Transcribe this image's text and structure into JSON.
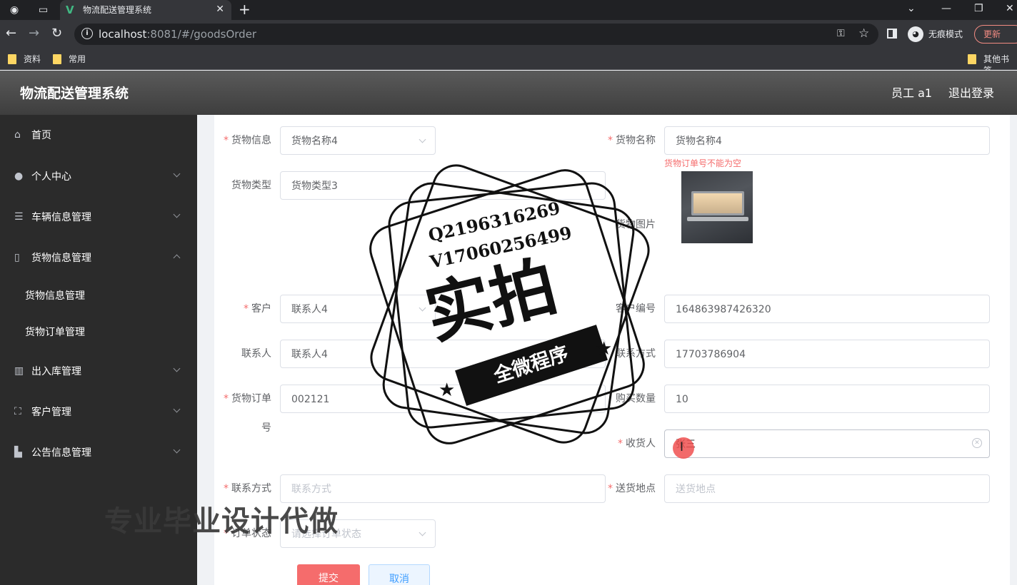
{
  "browser": {
    "tab_title": "物流配送管理系统",
    "url_host": "localhost",
    "url_rest": ":8081/#/goodsOrder",
    "incognito_label": "无痕模式",
    "update_label": "更新",
    "bookmarks": [
      "资料",
      "常用"
    ],
    "other_bookmarks": "其他书签"
  },
  "header": {
    "title": "物流配送管理系统",
    "user": "员工 a1",
    "logout": "退出登录"
  },
  "sidebar": {
    "items": [
      {
        "label": "首页",
        "icon": "home-icon"
      },
      {
        "label": "个人中心",
        "icon": "user-icon"
      },
      {
        "label": "车辆信息管理",
        "icon": "sliders-icon"
      },
      {
        "label": "货物信息管理",
        "icon": "phone-icon"
      },
      {
        "label": "货物信息管理",
        "icon": ""
      },
      {
        "label": "货物订单管理",
        "icon": ""
      },
      {
        "label": "出入库管理",
        "icon": "chart-icon"
      },
      {
        "label": "客户管理",
        "icon": "frame-icon"
      },
      {
        "label": "公告信息管理",
        "icon": "bank-icon"
      }
    ]
  },
  "form": {
    "goods_info": {
      "label": "货物信息",
      "value": "货物名称4"
    },
    "goods_name": {
      "label": "货物名称",
      "value": "货物名称4",
      "error": "货物订单号不能为空"
    },
    "goods_type": {
      "label": "货物类型",
      "value": "货物类型3"
    },
    "goods_image": {
      "label": "货物图片"
    },
    "customer": {
      "label": "客户",
      "value": "联系人4"
    },
    "customer_no": {
      "label": "客户编号",
      "value": "164863987426320"
    },
    "contact": {
      "label": "联系人",
      "value": "联系人4"
    },
    "contact_phone": {
      "label": "联系方式",
      "value": "17703786904"
    },
    "order_no": {
      "label_line1": "货物订单",
      "label_line2": "号",
      "value": "002121"
    },
    "quantity": {
      "label": "购买数量",
      "value": "10"
    },
    "receiver": {
      "label": "收货人",
      "value": "张三"
    },
    "receiver_phone": {
      "label": "联系方式",
      "placeholder": "联系方式"
    },
    "delivery_address": {
      "label": "送货地点",
      "placeholder": "送货地点"
    },
    "order_status": {
      "label": "订单状态",
      "placeholder": "请选择订单状态"
    },
    "submit": "提交",
    "cancel": "取消"
  },
  "watermark": {
    "line1": "Q2196316269",
    "line2": "V17060256499",
    "big": "实拍",
    "banner": "全微程序",
    "bottom": "专业毕业设计代做"
  }
}
